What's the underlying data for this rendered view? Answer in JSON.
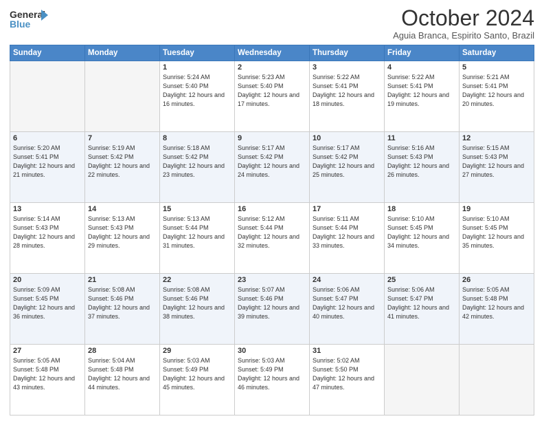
{
  "header": {
    "logo_line1": "General",
    "logo_line2": "Blue",
    "month_title": "October 2024",
    "location": "Aguia Branca, Espirito Santo, Brazil"
  },
  "weekdays": [
    "Sunday",
    "Monday",
    "Tuesday",
    "Wednesday",
    "Thursday",
    "Friday",
    "Saturday"
  ],
  "weeks": [
    [
      {
        "day": "",
        "empty": true
      },
      {
        "day": "",
        "empty": true
      },
      {
        "day": "1",
        "sunrise": "5:24 AM",
        "sunset": "5:40 PM",
        "daylight": "12 hours and 16 minutes."
      },
      {
        "day": "2",
        "sunrise": "5:23 AM",
        "sunset": "5:40 PM",
        "daylight": "12 hours and 17 minutes."
      },
      {
        "day": "3",
        "sunrise": "5:22 AM",
        "sunset": "5:41 PM",
        "daylight": "12 hours and 18 minutes."
      },
      {
        "day": "4",
        "sunrise": "5:22 AM",
        "sunset": "5:41 PM",
        "daylight": "12 hours and 19 minutes."
      },
      {
        "day": "5",
        "sunrise": "5:21 AM",
        "sunset": "5:41 PM",
        "daylight": "12 hours and 20 minutes."
      }
    ],
    [
      {
        "day": "6",
        "sunrise": "5:20 AM",
        "sunset": "5:41 PM",
        "daylight": "12 hours and 21 minutes."
      },
      {
        "day": "7",
        "sunrise": "5:19 AM",
        "sunset": "5:42 PM",
        "daylight": "12 hours and 22 minutes."
      },
      {
        "day": "8",
        "sunrise": "5:18 AM",
        "sunset": "5:42 PM",
        "daylight": "12 hours and 23 minutes."
      },
      {
        "day": "9",
        "sunrise": "5:17 AM",
        "sunset": "5:42 PM",
        "daylight": "12 hours and 24 minutes."
      },
      {
        "day": "10",
        "sunrise": "5:17 AM",
        "sunset": "5:42 PM",
        "daylight": "12 hours and 25 minutes."
      },
      {
        "day": "11",
        "sunrise": "5:16 AM",
        "sunset": "5:43 PM",
        "daylight": "12 hours and 26 minutes."
      },
      {
        "day": "12",
        "sunrise": "5:15 AM",
        "sunset": "5:43 PM",
        "daylight": "12 hours and 27 minutes."
      }
    ],
    [
      {
        "day": "13",
        "sunrise": "5:14 AM",
        "sunset": "5:43 PM",
        "daylight": "12 hours and 28 minutes."
      },
      {
        "day": "14",
        "sunrise": "5:13 AM",
        "sunset": "5:43 PM",
        "daylight": "12 hours and 29 minutes."
      },
      {
        "day": "15",
        "sunrise": "5:13 AM",
        "sunset": "5:44 PM",
        "daylight": "12 hours and 31 minutes."
      },
      {
        "day": "16",
        "sunrise": "5:12 AM",
        "sunset": "5:44 PM",
        "daylight": "12 hours and 32 minutes."
      },
      {
        "day": "17",
        "sunrise": "5:11 AM",
        "sunset": "5:44 PM",
        "daylight": "12 hours and 33 minutes."
      },
      {
        "day": "18",
        "sunrise": "5:10 AM",
        "sunset": "5:45 PM",
        "daylight": "12 hours and 34 minutes."
      },
      {
        "day": "19",
        "sunrise": "5:10 AM",
        "sunset": "5:45 PM",
        "daylight": "12 hours and 35 minutes."
      }
    ],
    [
      {
        "day": "20",
        "sunrise": "5:09 AM",
        "sunset": "5:45 PM",
        "daylight": "12 hours and 36 minutes."
      },
      {
        "day": "21",
        "sunrise": "5:08 AM",
        "sunset": "5:46 PM",
        "daylight": "12 hours and 37 minutes."
      },
      {
        "day": "22",
        "sunrise": "5:08 AM",
        "sunset": "5:46 PM",
        "daylight": "12 hours and 38 minutes."
      },
      {
        "day": "23",
        "sunrise": "5:07 AM",
        "sunset": "5:46 PM",
        "daylight": "12 hours and 39 minutes."
      },
      {
        "day": "24",
        "sunrise": "5:06 AM",
        "sunset": "5:47 PM",
        "daylight": "12 hours and 40 minutes."
      },
      {
        "day": "25",
        "sunrise": "5:06 AM",
        "sunset": "5:47 PM",
        "daylight": "12 hours and 41 minutes."
      },
      {
        "day": "26",
        "sunrise": "5:05 AM",
        "sunset": "5:48 PM",
        "daylight": "12 hours and 42 minutes."
      }
    ],
    [
      {
        "day": "27",
        "sunrise": "5:05 AM",
        "sunset": "5:48 PM",
        "daylight": "12 hours and 43 minutes."
      },
      {
        "day": "28",
        "sunrise": "5:04 AM",
        "sunset": "5:48 PM",
        "daylight": "12 hours and 44 minutes."
      },
      {
        "day": "29",
        "sunrise": "5:03 AM",
        "sunset": "5:49 PM",
        "daylight": "12 hours and 45 minutes."
      },
      {
        "day": "30",
        "sunrise": "5:03 AM",
        "sunset": "5:49 PM",
        "daylight": "12 hours and 46 minutes."
      },
      {
        "day": "31",
        "sunrise": "5:02 AM",
        "sunset": "5:50 PM",
        "daylight": "12 hours and 47 minutes."
      },
      {
        "day": "",
        "empty": true
      },
      {
        "day": "",
        "empty": true
      }
    ]
  ],
  "labels": {
    "sunrise_label": "Sunrise:",
    "sunset_label": "Sunset:",
    "daylight_label": "Daylight:"
  }
}
